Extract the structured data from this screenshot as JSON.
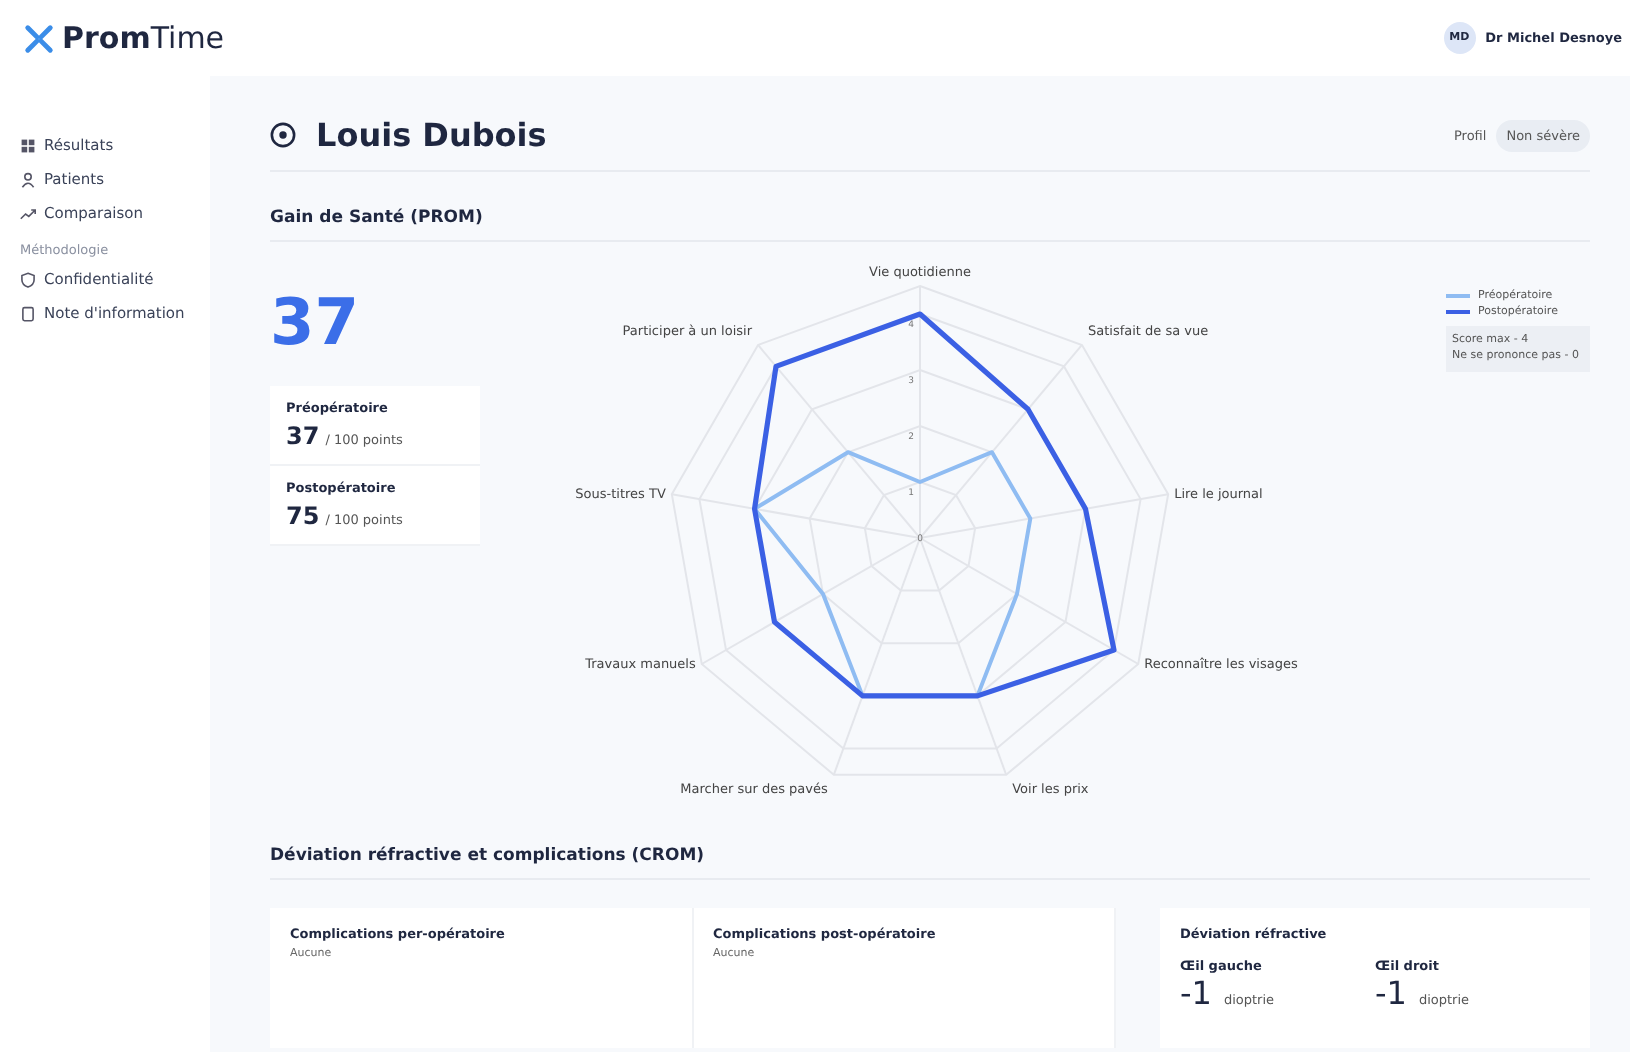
{
  "header": {
    "logo_bold": "Prom",
    "logo_light": "Time",
    "user": {
      "initials": "MD",
      "name": "Dr Michel Desnoye"
    }
  },
  "sidebar": {
    "items": [
      {
        "label": "Résultats"
      },
      {
        "label": "Patients"
      },
      {
        "label": "Comparaison"
      }
    ],
    "section": "Méthodologie",
    "section_items": [
      {
        "label": "Confidentialité"
      },
      {
        "label": "Note d'information"
      }
    ]
  },
  "patient": {
    "name": "Louis Dubois",
    "profile_label": "Profil",
    "profile_value": "Non sévère"
  },
  "prom": {
    "title": "Gain de Santé (PROM)",
    "gain": "37",
    "scores": [
      {
        "label": "Préopératoire",
        "value": "37",
        "unit": "/ 100 points"
      },
      {
        "label": "Postopératoire",
        "value": "75",
        "unit": "/ 100 points"
      }
    ],
    "legend_notes": [
      "Score max - 4",
      "Ne se prononce pas - 0"
    ],
    "chart_data": {
      "type": "radar",
      "categories": [
        "Vie quotidienne",
        "Satisfait de sa vue",
        "Lire le journal",
        "Reconnaître les visages",
        "Voir les prix",
        "Marcher sur des pavés",
        "Travaux manuels",
        "Sous-titres TV",
        "Participer à un loisir"
      ],
      "ylim": [
        0,
        4.5
      ],
      "yticks": [
        0,
        1,
        2,
        3,
        4
      ],
      "series": [
        {
          "name": "Préopératoire",
          "color": "#8fbcf2",
          "values": [
            1,
            2,
            2,
            2,
            3,
            3,
            2,
            3,
            2
          ]
        },
        {
          "name": "Postopératoire",
          "color": "#3b60e4",
          "values": [
            4,
            3,
            3,
            4,
            3,
            3,
            3,
            3,
            4
          ]
        }
      ]
    }
  },
  "crom": {
    "title": "Déviation réfractive et complications (CROM)",
    "complications": [
      {
        "label": "Complications per-opératoire",
        "value": "Aucune"
      },
      {
        "label": "Complications post-opératoire",
        "value": "Aucune"
      }
    ],
    "deviation": {
      "title": "Déviation réfractive",
      "eyes": [
        {
          "label": "Œil gauche",
          "value": "-1",
          "unit": "dioptrie"
        },
        {
          "label": "Œil droit",
          "value": "-1",
          "unit": "dioptrie"
        }
      ]
    }
  }
}
